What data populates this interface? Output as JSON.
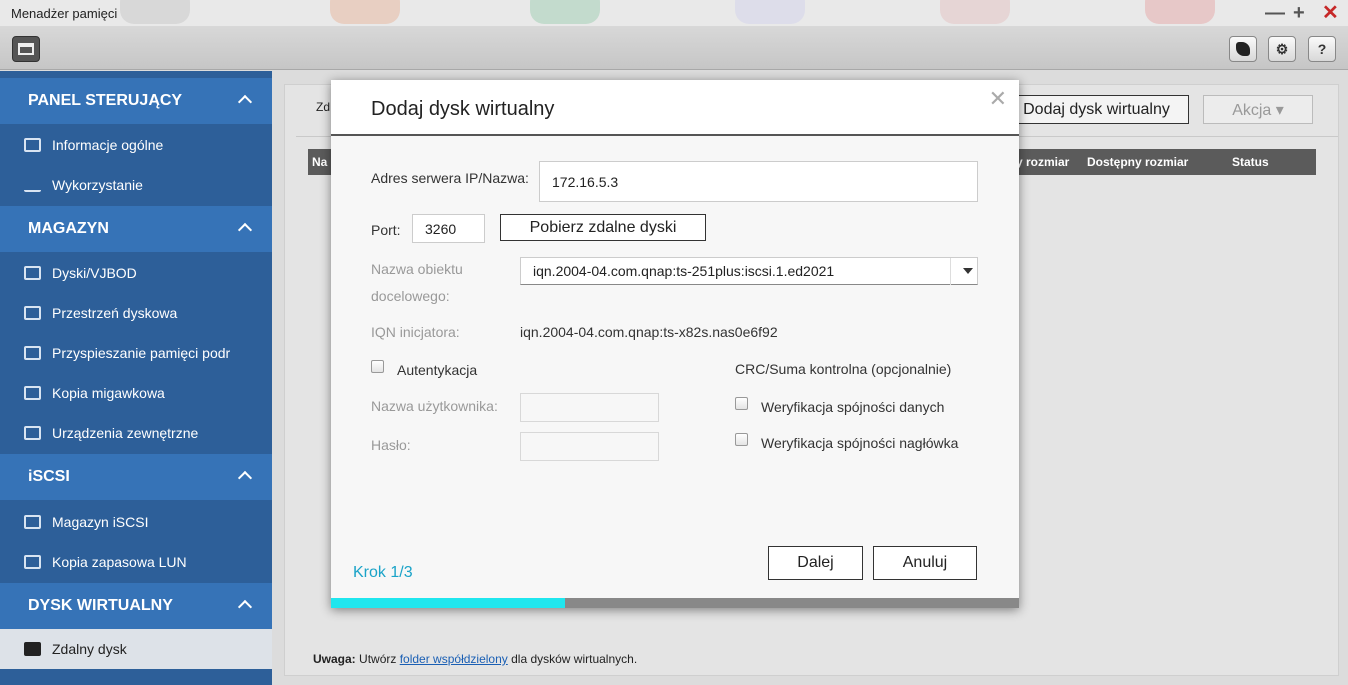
{
  "window": {
    "title": "Menadżer pamięci",
    "controls": {
      "minimize": "—",
      "maximize": "+",
      "close": "✕"
    }
  },
  "toolbar": {
    "help_label": "?"
  },
  "sidebar": {
    "sections": [
      {
        "title": "PANEL STERUJĄCY",
        "items": [
          {
            "label": "Informacje ogólne",
            "icon": "list-icon"
          },
          {
            "label": "Wykorzystanie",
            "icon": "bars-chart-icon"
          }
        ]
      },
      {
        "title": "MAGAZYN",
        "items": [
          {
            "label": "Dyski/VJBOD",
            "icon": "disk-icon"
          },
          {
            "label": "Przestrzeń dyskowa",
            "icon": "storage-stack-icon"
          },
          {
            "label": "Przyspieszanie pamięci podr",
            "icon": "cache-drive-icon"
          },
          {
            "label": "Kopia migawkowa",
            "icon": "snapshot-icon"
          },
          {
            "label": "Urządzenia zewnętrzne",
            "icon": "external-device-icon"
          }
        ]
      },
      {
        "title": "iSCSI",
        "items": [
          {
            "label": "Magazyn iSCSI",
            "icon": "iscsi-storage-icon"
          },
          {
            "label": "Kopia zapasowa LUN",
            "icon": "lun-backup-icon"
          }
        ]
      },
      {
        "title": "DYSK WIRTUALNY",
        "items": [
          {
            "label": "Zdalny dysk",
            "icon": "remote-disk-icon",
            "active": true
          }
        ]
      }
    ]
  },
  "background": {
    "tab_fragment": "Zd",
    "add_button": "Dodaj dysk wirtualny",
    "action_button": "Akcja ▾",
    "table_headers": {
      "name_fragment": "Na",
      "size_fragment": "y rozmiar",
      "available": "Dostępny rozmiar",
      "status": "Status"
    },
    "note": {
      "prefix": "Uwaga:",
      "text1": " Utwórz ",
      "link": "folder współdzielony",
      "text2": " dla dysków wirtualnych."
    }
  },
  "dialog": {
    "title": "Dodaj dysk wirtualny",
    "server_label": "Adres serwera IP/Nazwa:",
    "server_value": "172.16.5.3",
    "port_label": "Port:",
    "port_value": "3260",
    "fetch_button": "Pobierz zdalne dyski",
    "target_label_1": "Nazwa obiektu",
    "target_label_2": "docelowego:",
    "target_value": "iqn.2004-04.com.qnap:ts-251plus:iscsi.1.ed2021",
    "initiator_label": "IQN inicjatora:",
    "initiator_value": "iqn.2004-04.com.qnap:ts-x82s.nas0e6f92",
    "auth_label": "Autentykacja",
    "auth_checked": false,
    "username_label": "Nazwa użytkownika:",
    "password_label": "Hasło:",
    "crc_label": "CRC/Suma kontrolna (opcjonalnie)",
    "data_digest_label": "Weryfikacja spójności danych",
    "header_digest_label": "Weryfikacja spójności nagłówka",
    "step": "Krok 1/3",
    "next_button": "Dalej",
    "cancel_button": "Anuluj",
    "progress": 0.34,
    "progress_color": "#20e6ee"
  }
}
